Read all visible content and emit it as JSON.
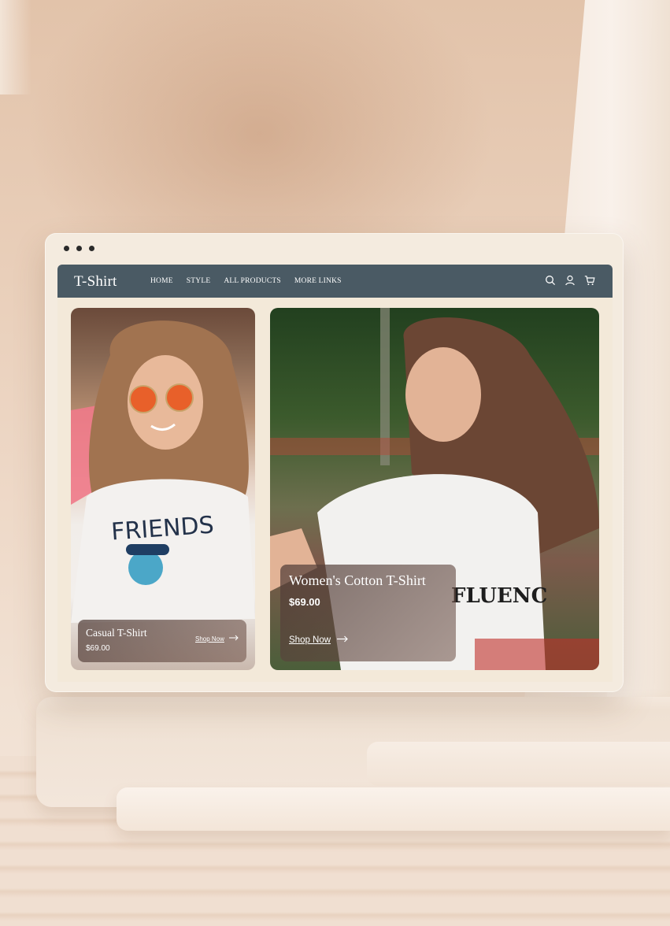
{
  "site": {
    "brand": "T-Shirt",
    "menu": [
      "HOME",
      "STYLE",
      "ALL PRODUCTS",
      "MORE LINKS"
    ],
    "icons": [
      "search-icon",
      "user-icon",
      "cart-icon"
    ]
  },
  "products": [
    {
      "title": "Casual T-Shirt",
      "price": "$69.00",
      "link": "Shop Now",
      "shirt_print": "FRIENDS"
    },
    {
      "title": "Women's Cotton T-Shirt",
      "price": "$69.00",
      "link": "Shop Now",
      "shirt_print": "FLUENC"
    }
  ],
  "colors": {
    "nav": "#4a5a64",
    "window": "#f4ebdf",
    "background": "#e9cfba"
  }
}
